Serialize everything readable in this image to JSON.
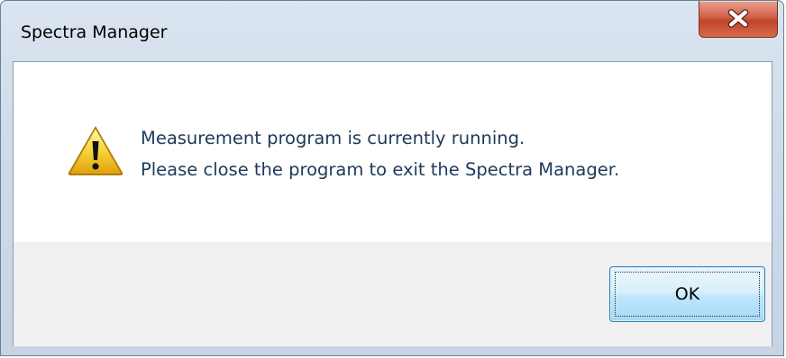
{
  "window": {
    "title": "Spectra Manager"
  },
  "titlebar": {
    "close_icon": "close-icon"
  },
  "message": {
    "icon": "warning-icon",
    "line1": "Measurement program is currently running.",
    "line2": "Please close the program to exit the Spectra Manager."
  },
  "buttons": {
    "ok_label": "OK"
  },
  "colors": {
    "message_text": "#1e395b",
    "close_button": "#c24329",
    "ok_border": "#3c7fb1",
    "footer_bg": "#f0f0f0"
  }
}
